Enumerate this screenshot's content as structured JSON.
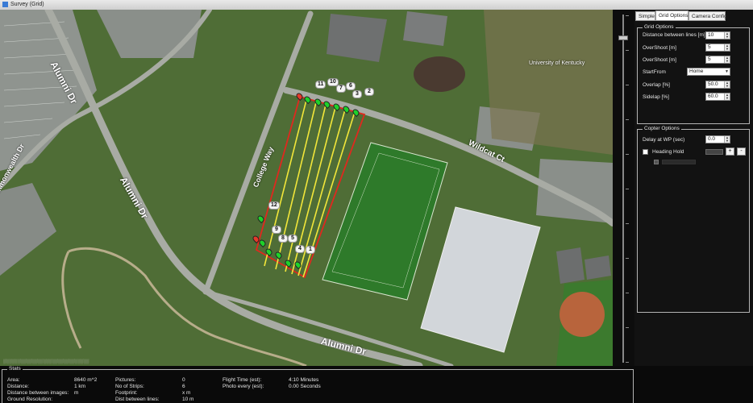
{
  "window": {
    "title": "Survey (Grid)"
  },
  "tabs": [
    {
      "label": "Simple"
    },
    {
      "label": "Grid Options"
    },
    {
      "label": "Camera Config"
    }
  ],
  "grid_options": {
    "title": "Grid Options",
    "distance_between_lines": {
      "label": "Distance between lines [m]",
      "value": "10"
    },
    "overshoot1": {
      "label": "OverShoot [m]",
      "value": "5"
    },
    "overshoot2": {
      "label": "OverShoot [m]",
      "value": "5"
    },
    "start_from": {
      "label": "StartFrom",
      "value": "Home"
    },
    "overlap": {
      "label": "Overlap [%]",
      "value": "50.0"
    },
    "sidelap": {
      "label": "Sidelap [%]",
      "value": "60.0"
    }
  },
  "copter_options": {
    "title": "Copter Options",
    "delay_at_wp": {
      "label": "Delay at WP (sec)",
      "value": "0.0"
    },
    "heading_hold": {
      "label": "Heading Hold",
      "checked": false
    },
    "plus": "+",
    "minus": "-"
  },
  "map": {
    "roads": [
      "Alumni Dr",
      "Alumni Dr",
      "Alumni Dr",
      "College Way",
      "Wildcat Ct",
      "Commonwealth Dr"
    ],
    "place": "University of Kentucky",
    "waypoints": [
      "1",
      "2",
      "3",
      "4",
      "5",
      "6",
      "7",
      "8",
      "9",
      "10",
      "11",
      "12"
    ]
  },
  "stats": {
    "title": "Stats",
    "area": {
      "label": "Area:",
      "value": "8640 m^2"
    },
    "distance": {
      "label": "Distance:",
      "value": "1 km"
    },
    "distance_between_images": {
      "label": "Distance between images:",
      "value": "m"
    },
    "ground_resolution": {
      "label": "Ground Resolution:",
      "value": ""
    },
    "pictures": {
      "label": "Pictures:",
      "value": "0"
    },
    "strips": {
      "label": "No of Strips:",
      "value": "6"
    },
    "footprint": {
      "label": "Footprint:",
      "value": "x m"
    },
    "dist_between_lines": {
      "label": "Dist between lines:",
      "value": "10 m"
    },
    "flight_time": {
      "label": "Flight Time (est):",
      "value": "4:10 Minutes"
    },
    "photo_every": {
      "label": "Photo every (est):",
      "value": "0.00 Seconds"
    }
  },
  "colors": {
    "grid_lines": "#f2e63a",
    "boundary": "#e0281e",
    "marker_green": "#1ed12a",
    "marker_red": "#e53a2a"
  }
}
